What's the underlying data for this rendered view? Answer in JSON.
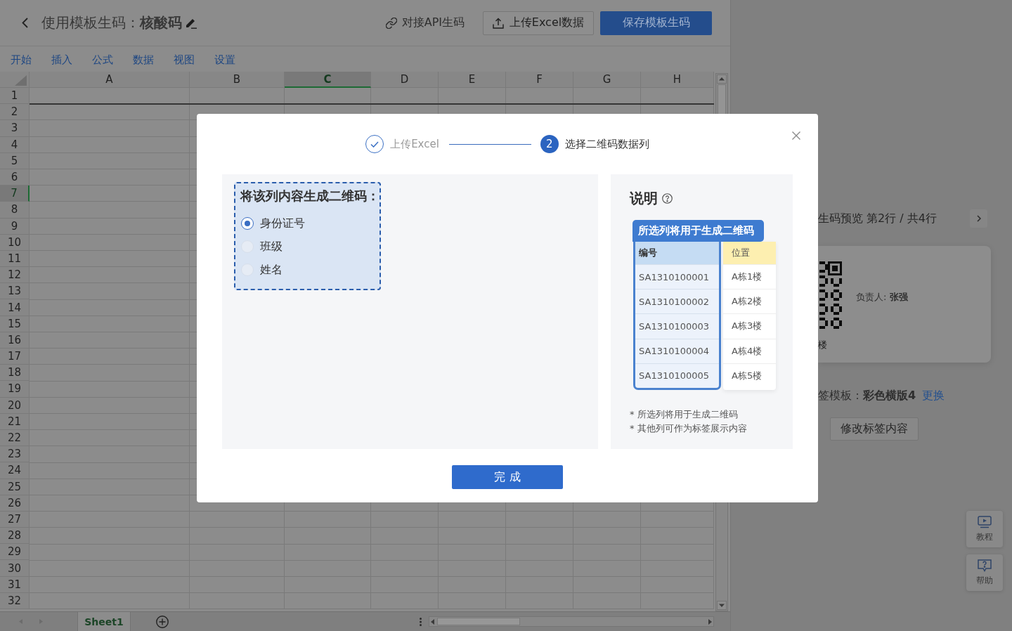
{
  "header": {
    "title": "使用模板生码：**核酸码**",
    "actions": [
      {
        "kind": "link",
        "label": "对接API生码"
      },
      {
        "kind": "outline",
        "label": "上传Excel数据"
      },
      {
        "kind": "primary",
        "label": "保存模板生码"
      }
    ]
  },
  "ribbon_tabs": [
    "开始",
    "插入",
    "公式",
    "数据",
    "视图",
    "设置"
  ],
  "sheet": {
    "columns": [
      {
        "label": "A",
        "selected": false
      },
      {
        "label": "B",
        "selected": false
      },
      {
        "label": "C",
        "selected": true
      },
      {
        "label": "D",
        "selected": false
      },
      {
        "label": "E",
        "selected": false
      },
      {
        "label": "F",
        "selected": false
      },
      {
        "label": "G",
        "selected": false
      },
      {
        "label": "H",
        "selected": false
      }
    ],
    "rows": [
      {
        "label": "1",
        "selected": false
      },
      {
        "label": "2",
        "selected": false
      },
      {
        "label": "3",
        "selected": false
      },
      {
        "label": "4",
        "selected": false
      },
      {
        "label": "5",
        "selected": false
      },
      {
        "label": "6",
        "selected": false
      },
      {
        "label": "7",
        "selected": true
      },
      {
        "label": "8",
        "selected": false
      },
      {
        "label": "9",
        "selected": false
      },
      {
        "label": "10",
        "selected": false
      },
      {
        "label": "11",
        "selected": false
      },
      {
        "label": "12",
        "selected": false
      },
      {
        "label": "13",
        "selected": false
      },
      {
        "label": "14",
        "selected": false
      },
      {
        "label": "15",
        "selected": false
      },
      {
        "label": "16",
        "selected": false
      },
      {
        "label": "17",
        "selected": false
      },
      {
        "label": "18",
        "selected": false
      },
      {
        "label": "19",
        "selected": false
      },
      {
        "label": "20",
        "selected": false
      },
      {
        "label": "21",
        "selected": false
      },
      {
        "label": "22",
        "selected": false
      },
      {
        "label": "23",
        "selected": false
      },
      {
        "label": "24",
        "selected": false
      },
      {
        "label": "25",
        "selected": false
      },
      {
        "label": "26",
        "selected": false
      },
      {
        "label": "27",
        "selected": false
      },
      {
        "label": "28",
        "selected": false
      },
      {
        "label": "29",
        "selected": false
      },
      {
        "label": "30",
        "selected": false
      },
      {
        "label": "31",
        "selected": false
      },
      {
        "label": "32",
        "selected": false
      }
    ],
    "frozen_first_row": true,
    "tabs": [
      {
        "label": "Sheet1",
        "selected": true
      }
    ]
  },
  "preview": {
    "title": "生码预览 第2行 / 共4行",
    "label_field": "负责人: **张强**",
    "label_caption": "楼",
    "template": "签模板：**彩色横版4**",
    "template_link": "更换",
    "edit_button": "修改标签内容"
  },
  "float_buttons": [
    {
      "kind": "tutorial",
      "label": "教程"
    },
    {
      "kind": "help",
      "label": "帮助"
    }
  ],
  "modal": {
    "steps": [
      {
        "label": "上传Excel",
        "done": true,
        "current": false
      },
      {
        "label": "选择二维码数据列",
        "number": "2",
        "done": false,
        "current": true
      }
    ],
    "question": "将该列内容生成二维码：",
    "options": [
      {
        "label": "身份证号",
        "selected": true
      },
      {
        "label": "班级",
        "selected": false
      },
      {
        "label": "姓名",
        "selected": false
      }
    ],
    "note": {
      "title": "说明",
      "banner": "所选列将用于生成二维码",
      "table": {
        "columns": [
          {
            "label": "编号",
            "selected": true
          },
          {
            "label": "位置",
            "selected": false
          }
        ],
        "rows": [
          [
            "SA1310100001",
            "A栋1楼"
          ],
          [
            "SA1310100002",
            "A栋2楼"
          ],
          [
            "SA1310100003",
            "A栋3楼"
          ],
          [
            "SA1310100004",
            "A栋4楼"
          ],
          [
            "SA1310100005",
            "A栋5楼"
          ]
        ]
      },
      "footnotes": [
        "* 所选列将用于生成二维码",
        "* 其他列可作为标签展示内容"
      ]
    },
    "submit": "完 成"
  }
}
